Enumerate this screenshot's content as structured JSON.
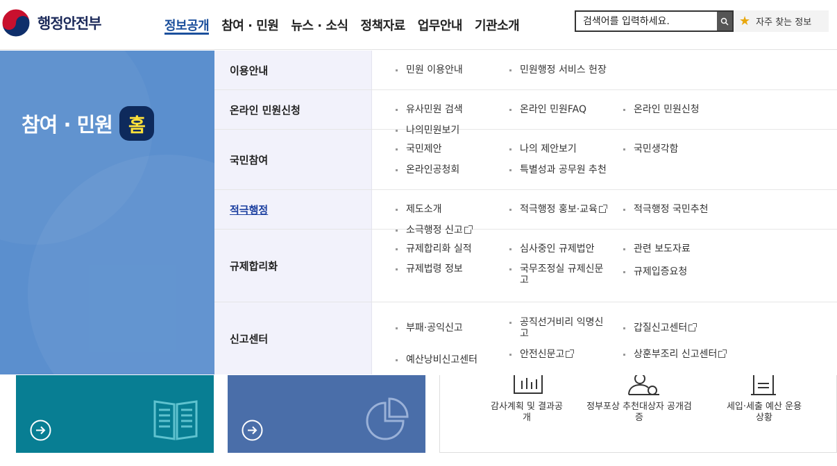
{
  "header": {
    "logo_text": "행정안전부",
    "nav": [
      {
        "label": "정보공개",
        "active": true
      },
      {
        "label": "참여 · 민원",
        "active": false
      },
      {
        "label": "뉴스 · 소식",
        "active": false
      },
      {
        "label": "정책자료",
        "active": false
      },
      {
        "label": "업무안내",
        "active": false
      },
      {
        "label": "기관소개",
        "active": false
      }
    ],
    "search_placeholder": "검색어를 입력하세요.",
    "fav_label": "자주 찾는 정보"
  },
  "mega": {
    "title": "참여 · 민원",
    "home_badge": "홈",
    "rows": [
      {
        "category": "이용안내",
        "items": [
          "민원 이용안내",
          "민원행정 서비스 헌장"
        ]
      },
      {
        "category": "온라인 민원신청",
        "items": [
          "유사민원 검색",
          "온라인 민원FAQ",
          "온라인 민원신청",
          "나의민원보기"
        ]
      },
      {
        "category": "국민참여",
        "items": [
          "국민제안",
          "나의 제안보기",
          "국민생각함",
          "온라인공청회",
          "특별성과 공무원 추천"
        ]
      },
      {
        "category": "적극행정",
        "items": [
          "제도소개",
          "적극행정 홍보·교육",
          "적극행정 국민추천",
          "소극행정 신고"
        ]
      },
      {
        "category": "규제합리화",
        "items": [
          "규제합리화 실적",
          "심사중인 규제법안",
          "관련 보도자료",
          "규제법령 정보",
          "국무조정실 규제신문고",
          "규제입증요청"
        ]
      },
      {
        "category": "신고센터",
        "items": [
          "부패·공익신고",
          "공직선거비리 익명신고",
          "갑질신고센터",
          "예산낭비신고센터",
          "안전신문고",
          "상훈부조리 신고센터"
        ]
      }
    ]
  },
  "quick": [
    {
      "label": "감사계획 및 결과공개",
      "icon": "presentation-icon"
    },
    {
      "label": "정부포상 추천대상자 공개검증",
      "icon": "award-person-icon"
    },
    {
      "label": "세입·세출 예산 운용상황",
      "icon": "document-icon"
    }
  ],
  "colors": {
    "mega_left": "#5b8fce",
    "card1": "#087e93",
    "card2": "#4a6ea9",
    "accent": "#1b4f9c"
  }
}
